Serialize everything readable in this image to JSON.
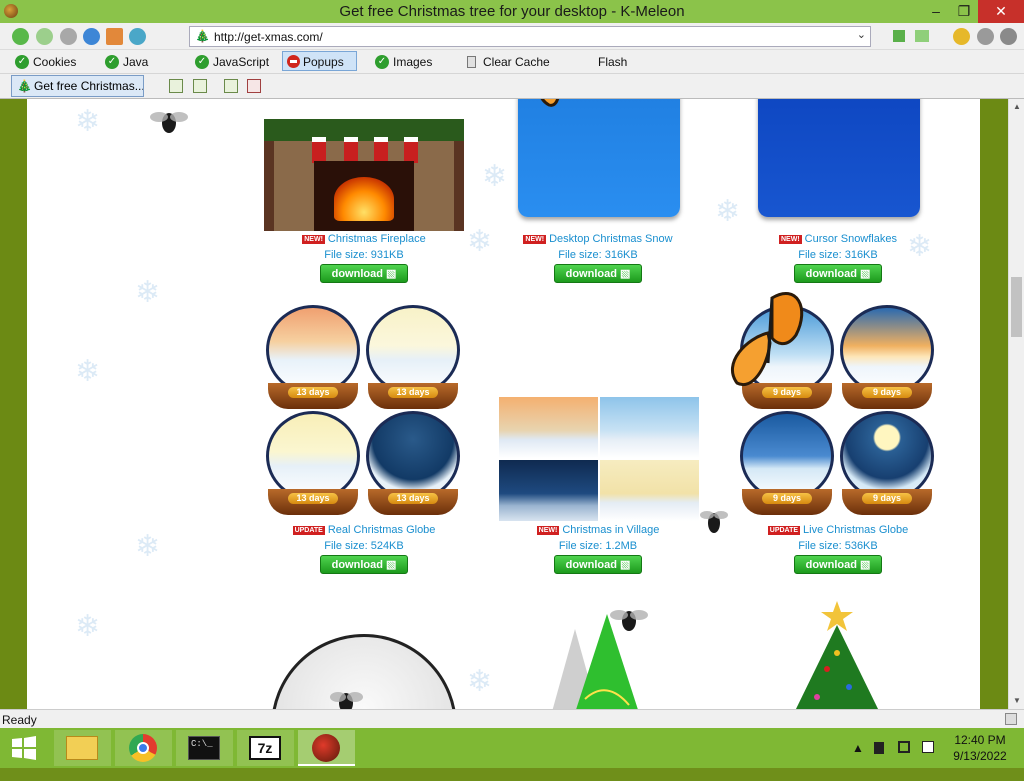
{
  "window": {
    "title": "Get free Christmas tree for your desktop - K-Meleon",
    "min": "–",
    "max": "❐",
    "close": "✕"
  },
  "navbar": {
    "url": "http://get-xmas.com/",
    "fav": "🎄",
    "dropdown": "⌄"
  },
  "toolbar": {
    "cookies": "Cookies",
    "java": "Java",
    "javascript": "JavaScript",
    "popups": "Popups",
    "images": "Images",
    "clear_cache": "Clear Cache",
    "flash": "Flash",
    "check": "✓"
  },
  "tab": {
    "label": "Get free Christmas...",
    "fav": "🎄"
  },
  "colors": {
    "accent": "#8bc34a",
    "link": "#1a8fcf",
    "download": "#1c9a1c"
  },
  "items": [
    {
      "badge": "NEW!",
      "name": "Christmas Fireplace",
      "size": "File size: 931KB",
      "button": "download ▧"
    },
    {
      "badge": "NEW!",
      "name": "Desktop Christmas Snow",
      "size": "File size: 316KB",
      "button": "download ▧"
    },
    {
      "badge": "NEW!",
      "name": "Cursor Snowflakes",
      "size": "File size: 316KB",
      "button": "download ▧"
    },
    {
      "badge": "UPDATE",
      "name": "Real Christmas Globe",
      "size": "File size: 524KB",
      "button": "download ▧"
    },
    {
      "badge": "NEW!",
      "name": "Christmas in Village",
      "size": "File size: 1.2MB",
      "button": "download ▧"
    },
    {
      "badge": "UPDATE",
      "name": "Live Christmas Globe",
      "size": "File size: 536KB",
      "button": "download ▧"
    }
  ],
  "globes": {
    "real": [
      "13 days",
      "13 days",
      "13 days",
      "13 days"
    ],
    "live": [
      "9 days",
      "9 days",
      "9 days",
      "9 days"
    ]
  },
  "status": {
    "text": "Ready"
  },
  "taskbar": {
    "time": "12:40 PM",
    "date": "9/13/2022",
    "sevenzip": "7z",
    "cmd": "C:\\_"
  }
}
